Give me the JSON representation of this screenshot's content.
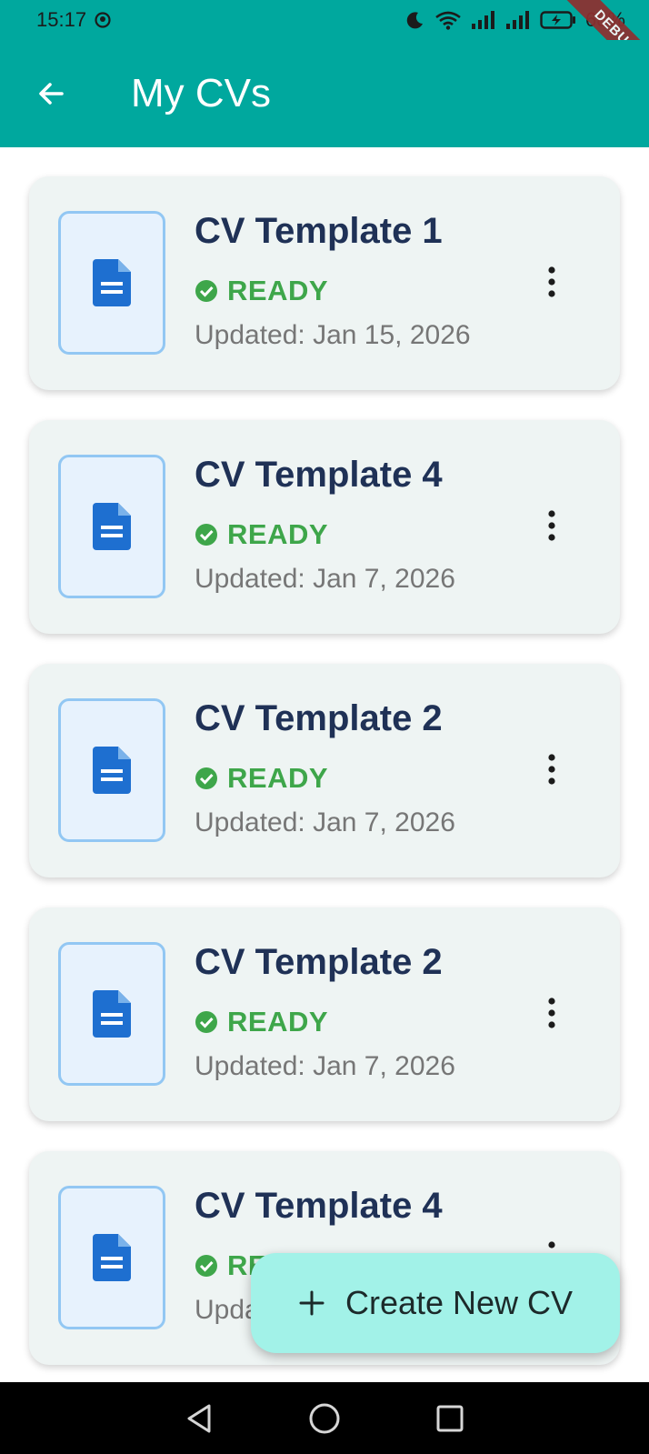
{
  "status_bar": {
    "time": "15:17",
    "battery": "68%",
    "icons": [
      "moon-icon",
      "wifi-icon",
      "signal-icon",
      "signal-icon",
      "battery-charging-icon"
    ]
  },
  "debug_banner": "DEBUG",
  "app_bar": {
    "title": "My CVs",
    "back_icon": "arrow-back-icon",
    "background": "#00a89e"
  },
  "cvs": [
    {
      "title": "CV Template 1",
      "status": "READY",
      "updated": "Updated: Jan 15, 2026"
    },
    {
      "title": "CV Template 4",
      "status": "READY",
      "updated": "Updated: Jan 7, 2026"
    },
    {
      "title": "CV Template 2",
      "status": "READY",
      "updated": "Updated: Jan 7, 2026"
    },
    {
      "title": "CV Template 2",
      "status": "READY",
      "updated": "Updated: Jan 7, 2026"
    },
    {
      "title": "CV Template 4",
      "status": "READY",
      "updated": "Updated: Jan 7, 2026"
    }
  ],
  "fab": {
    "label": "Create New CV",
    "icon": "plus-icon",
    "background": "#a2f2e8"
  },
  "colors": {
    "title": "#1f3156",
    "status_ready": "#3ea64a",
    "doc_icon": "#1e6fd0",
    "card_bg": "#eef4f3"
  },
  "nav_bar": {
    "buttons": [
      "back-triangle-icon",
      "home-circle-icon",
      "recents-square-icon"
    ]
  }
}
